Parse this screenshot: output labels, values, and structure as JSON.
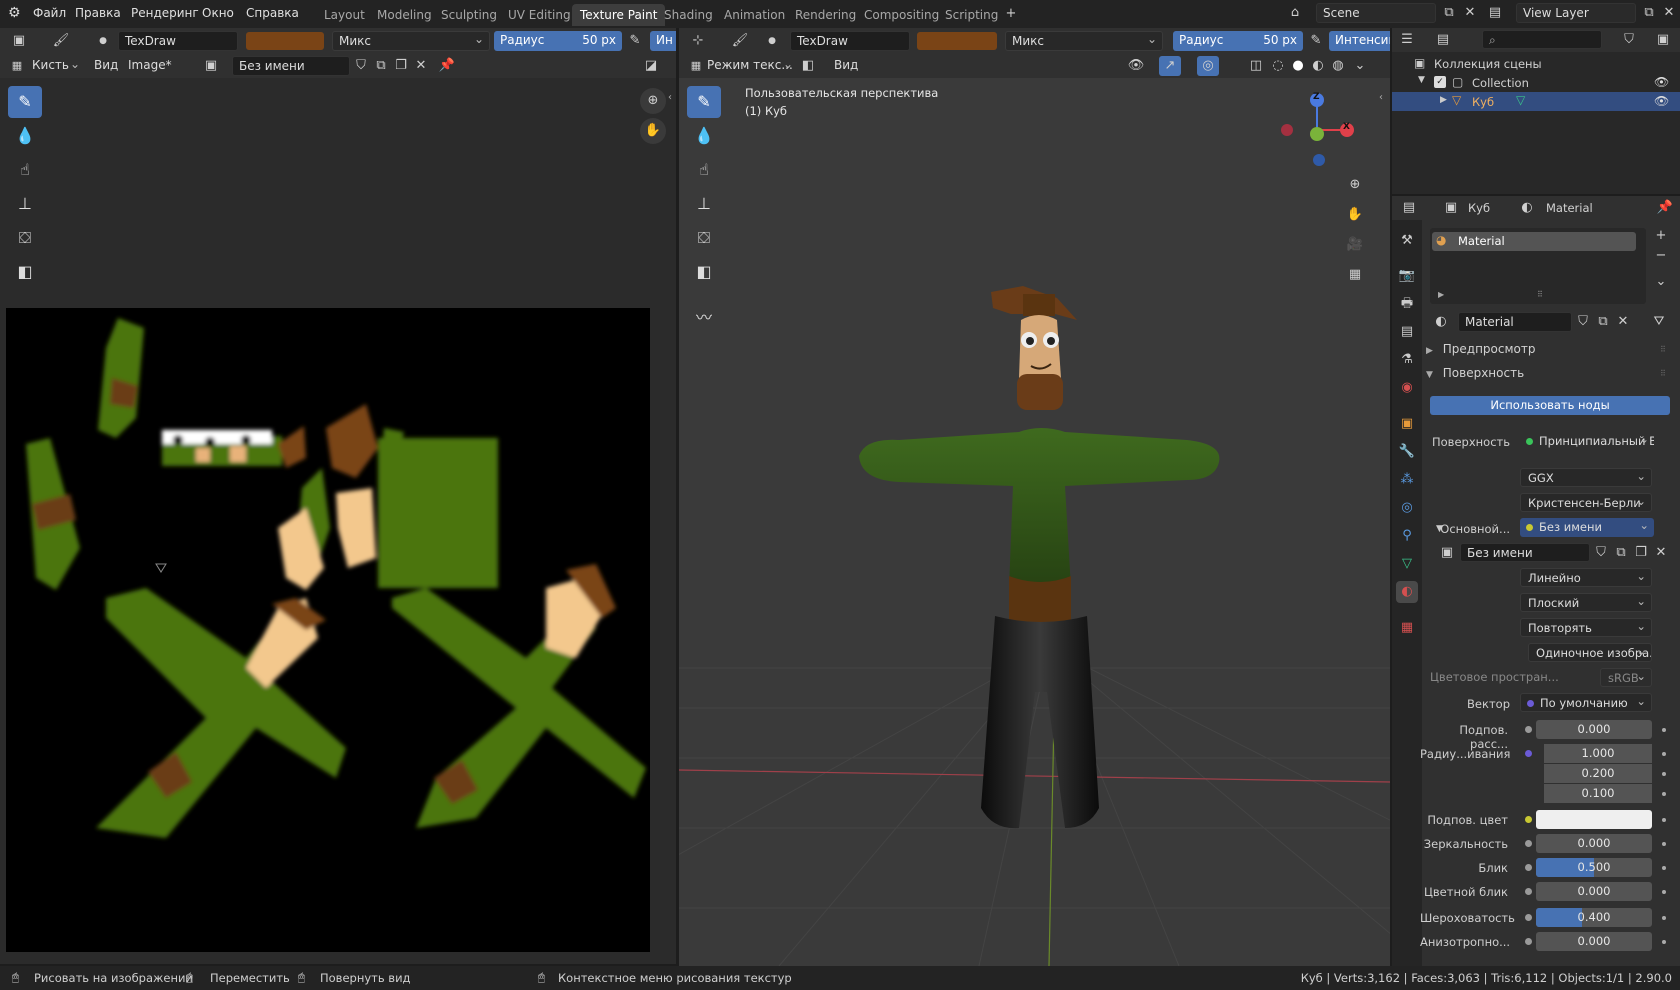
{
  "topbar": {
    "menus": [
      "Файл",
      "Правка",
      "Рендеринг",
      "Окно",
      "Справка"
    ],
    "workspaces": [
      "Layout",
      "Modeling",
      "Sculpting",
      "UV Editing",
      "Texture Paint",
      "Shading",
      "Animation",
      "Rendering",
      "Compositing",
      "Scripting"
    ],
    "active_workspace": "Texture Paint",
    "scene_name": "Scene",
    "view_layer": "View Layer"
  },
  "image_editor": {
    "brush_name": "TexDraw",
    "brush_color": "#7a4416",
    "blend_mode": "Микс",
    "radius_label": "Радиус",
    "radius_value": "50 px",
    "strength_short": "Ин",
    "menu_brush": "Кисть",
    "menu_view": "Вид",
    "menu_image": "Image*",
    "image_name": "Без имени"
  },
  "viewport": {
    "brush_name": "TexDraw",
    "brush_color": "#7a4416",
    "blend_mode": "Микс",
    "radius_label": "Радиус",
    "radius_value": "50 px",
    "strength_label": "Интенсив",
    "mode_label": "Режим текс...",
    "menu_view": "Вид",
    "overlay_line1": "Пользовательская перспектива",
    "overlay_line2": "(1) Куб",
    "gizmo_z": "Z",
    "gizmo_x": "X"
  },
  "outliner": {
    "root": "Коллекция сцены",
    "collection": "Collection",
    "object": "Куб"
  },
  "properties": {
    "object_name": "Куб",
    "material_tab": "Material",
    "slot_name": "Material",
    "material_name": "Material",
    "section_preview": "Предпросмотр",
    "section_surface": "Поверхность",
    "use_nodes_button": "Использовать ноды",
    "surface_label": "Поверхность",
    "surface_value": "Принципиальный В...",
    "distribution": "GGX",
    "subsurface_method": "Кристенсен-Берли",
    "base_label": "Основной...",
    "base_value": "Без имени",
    "image_name": "Без имени",
    "interpolation": "Линейно",
    "projection": "Плоский",
    "extension": "Повторять",
    "source": "Одиночное изобра...",
    "colorspace_label": "Цветовое простран...",
    "colorspace_value": "sRGB",
    "vector_label": "Вектор",
    "vector_value": "По умолчанию",
    "rows": [
      {
        "label": "Подпов. расс...",
        "value": "0.000",
        "dot": "#9a9a9a"
      },
      {
        "label": "Радиу...ивания",
        "value": "1.000",
        "dot": "#6b5bd6"
      },
      {
        "label": "",
        "value": "0.200",
        "dot": ""
      },
      {
        "label": "",
        "value": "0.100",
        "dot": ""
      },
      {
        "label": "Подпов. цвет",
        "value": "",
        "dot": "#c8c832"
      },
      {
        "label": "Зеркальность",
        "value": "0.000",
        "dot": "#9a9a9a"
      },
      {
        "label": "Блик",
        "value": "0.500",
        "dot": "#9a9a9a"
      },
      {
        "label": "Цветной блик",
        "value": "0.000",
        "dot": "#9a9a9a"
      },
      {
        "label": "Шероховатость",
        "value": "0.400",
        "dot": "#9a9a9a"
      },
      {
        "label": "Анизотропно...",
        "value": "0.000",
        "dot": "#9a9a9a"
      }
    ],
    "slider_fill": {
      "Блик": 0.5,
      "Шероховатость": 0.4
    }
  },
  "status_bar": {
    "left1": "Рисовать на изображении",
    "left2": "Переместить",
    "left3": "Повернуть вид",
    "center": "Контекстное меню рисования текстур",
    "right": "Куб | Verts:3,162 | Faces:3,063 | Tris:6,112 | Objects:1/1 | 2.90.0"
  }
}
